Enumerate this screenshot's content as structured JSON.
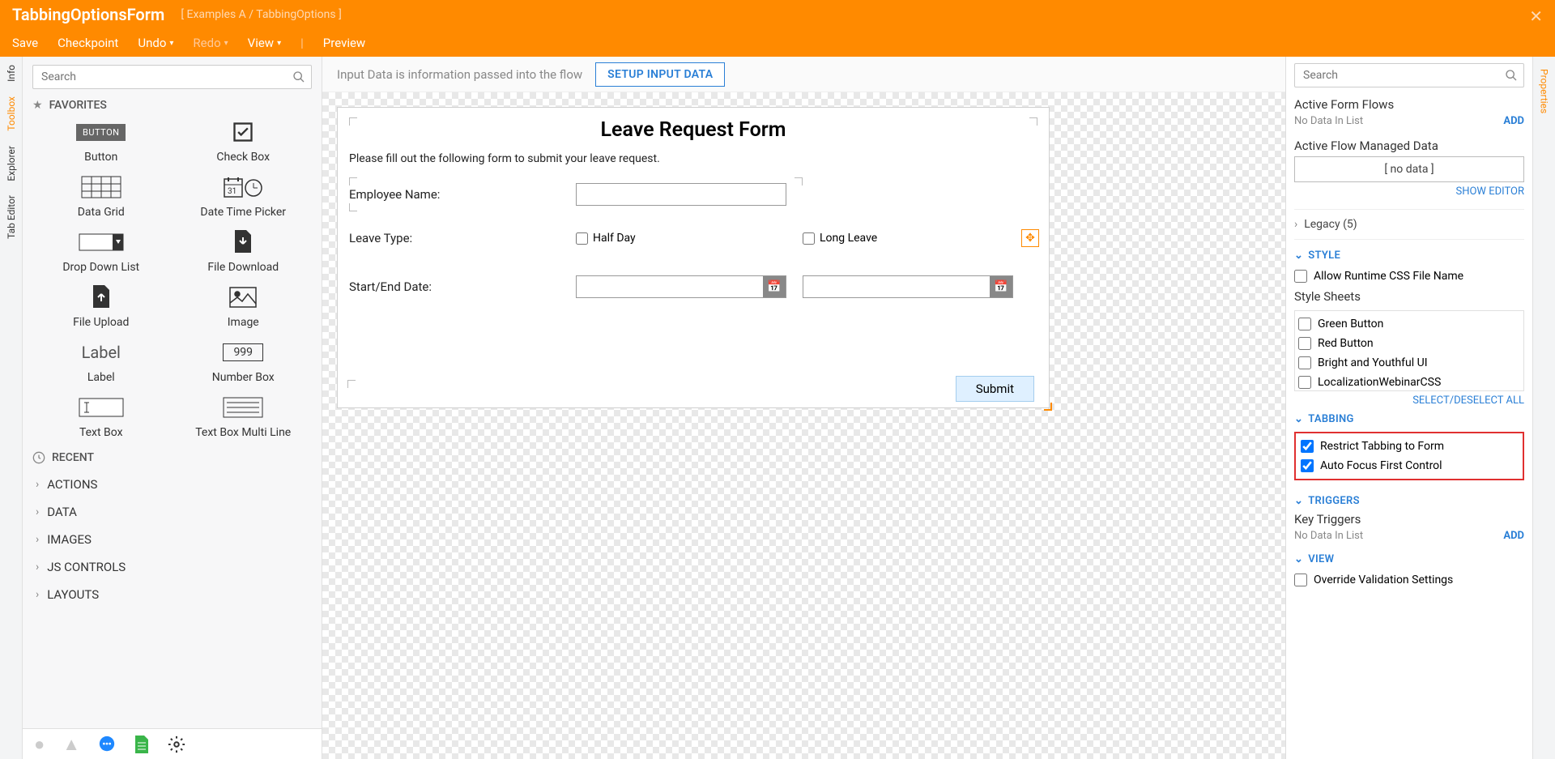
{
  "header": {
    "title": "TabbingOptionsForm",
    "breadcrumb": "[ Examples A / TabbingOptions ]",
    "menu": {
      "save": "Save",
      "checkpoint": "Checkpoint",
      "undo": "Undo",
      "redo": "Redo",
      "view": "View",
      "preview": "Preview"
    }
  },
  "leftTabs": {
    "info": "Info",
    "toolbox": "Toolbox",
    "explorer": "Explorer",
    "tab_editor": "Tab Editor"
  },
  "toolbox": {
    "search_ph": "Search",
    "favorites": "FAVORITES",
    "tools": {
      "button": "Button",
      "checkbox": "Check Box",
      "datagrid": "Data Grid",
      "datetime": "Date Time Picker",
      "dropdown": "Drop Down List",
      "filedl": "File Download",
      "fileup": "File Upload",
      "image": "Image",
      "label": "Label",
      "numbox": "Number Box",
      "textbox": "Text Box",
      "textboxml": "Text Box Multi Line"
    },
    "recent": "RECENT",
    "cats": {
      "actions": "ACTIONS",
      "data": "DATA",
      "images": "IMAGES",
      "js": "JS CONTROLS",
      "layouts": "LAYOUTS"
    }
  },
  "infobar": {
    "text": "Input Data is information passed into the flow",
    "btn": "SETUP INPUT DATA"
  },
  "form": {
    "title": "Leave Request Form",
    "subtitle": "Please fill out the following form to submit your leave request.",
    "emp_label": "Employee Name:",
    "leave_label": "Leave Type:",
    "halfday": "Half Day",
    "longleave": "Long Leave",
    "dates_label": "Start/End Date:",
    "submit": "Submit"
  },
  "props": {
    "search_ph": "Search",
    "aff": "Active Form Flows",
    "nodata": "No Data In List",
    "add": "ADD",
    "afmd": "Active Flow Managed Data",
    "nodata_box": "[ no data ]",
    "show_editor": "SHOW EDITOR",
    "legacy": "Legacy (5)",
    "style_h": "STYLE",
    "runtime_css": "Allow Runtime CSS File Name",
    "ss_label": "Style Sheets",
    "ss": [
      "Green Button",
      "Red Button",
      "Bright and Youthful UI",
      "LocalizationWebinarCSS"
    ],
    "ss_link": "SELECT/DESELECT ALL",
    "tabbing_h": "TABBING",
    "restrict": "Restrict Tabbing to Form",
    "autofocus": "Auto Focus First Control",
    "triggers_h": "TRIGGERS",
    "keytrig": "Key Triggers",
    "view_h": "VIEW",
    "override": "Override Validation Settings"
  },
  "rightTab": "Properties"
}
